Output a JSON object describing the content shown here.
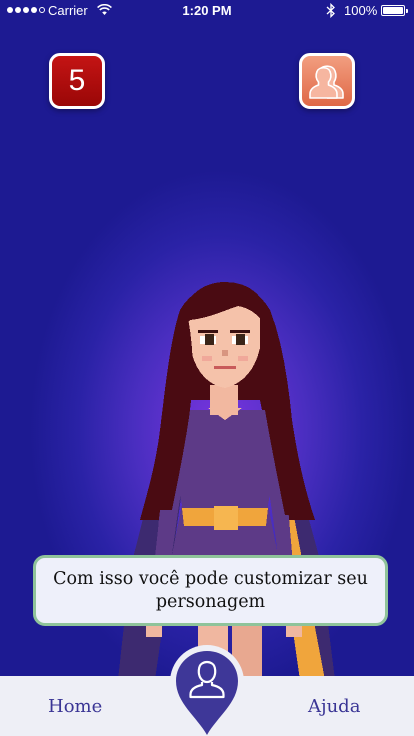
{
  "status_bar": {
    "carrier": "Carrier",
    "time": "1:20 PM",
    "battery": "100%",
    "icons": [
      "signal-dots",
      "wifi-icon",
      "bluetooth-icon",
      "battery-icon"
    ]
  },
  "top_buttons": {
    "level_value": "5",
    "friends_icon": "users-icon",
    "level_color": "#b00e0e",
    "friends_color": "#e8775a"
  },
  "dialog": {
    "message": "Com isso você pode customizar seu personagem"
  },
  "bottom_nav": {
    "home_label": "Home",
    "help_label": "Ajuda",
    "center_icon": "profile-pin-icon",
    "accent_color": "#3a3595"
  },
  "colors": {
    "background": "#2a22a6",
    "glow": "#7a35e0",
    "bubble_border": "#8fc39a"
  }
}
